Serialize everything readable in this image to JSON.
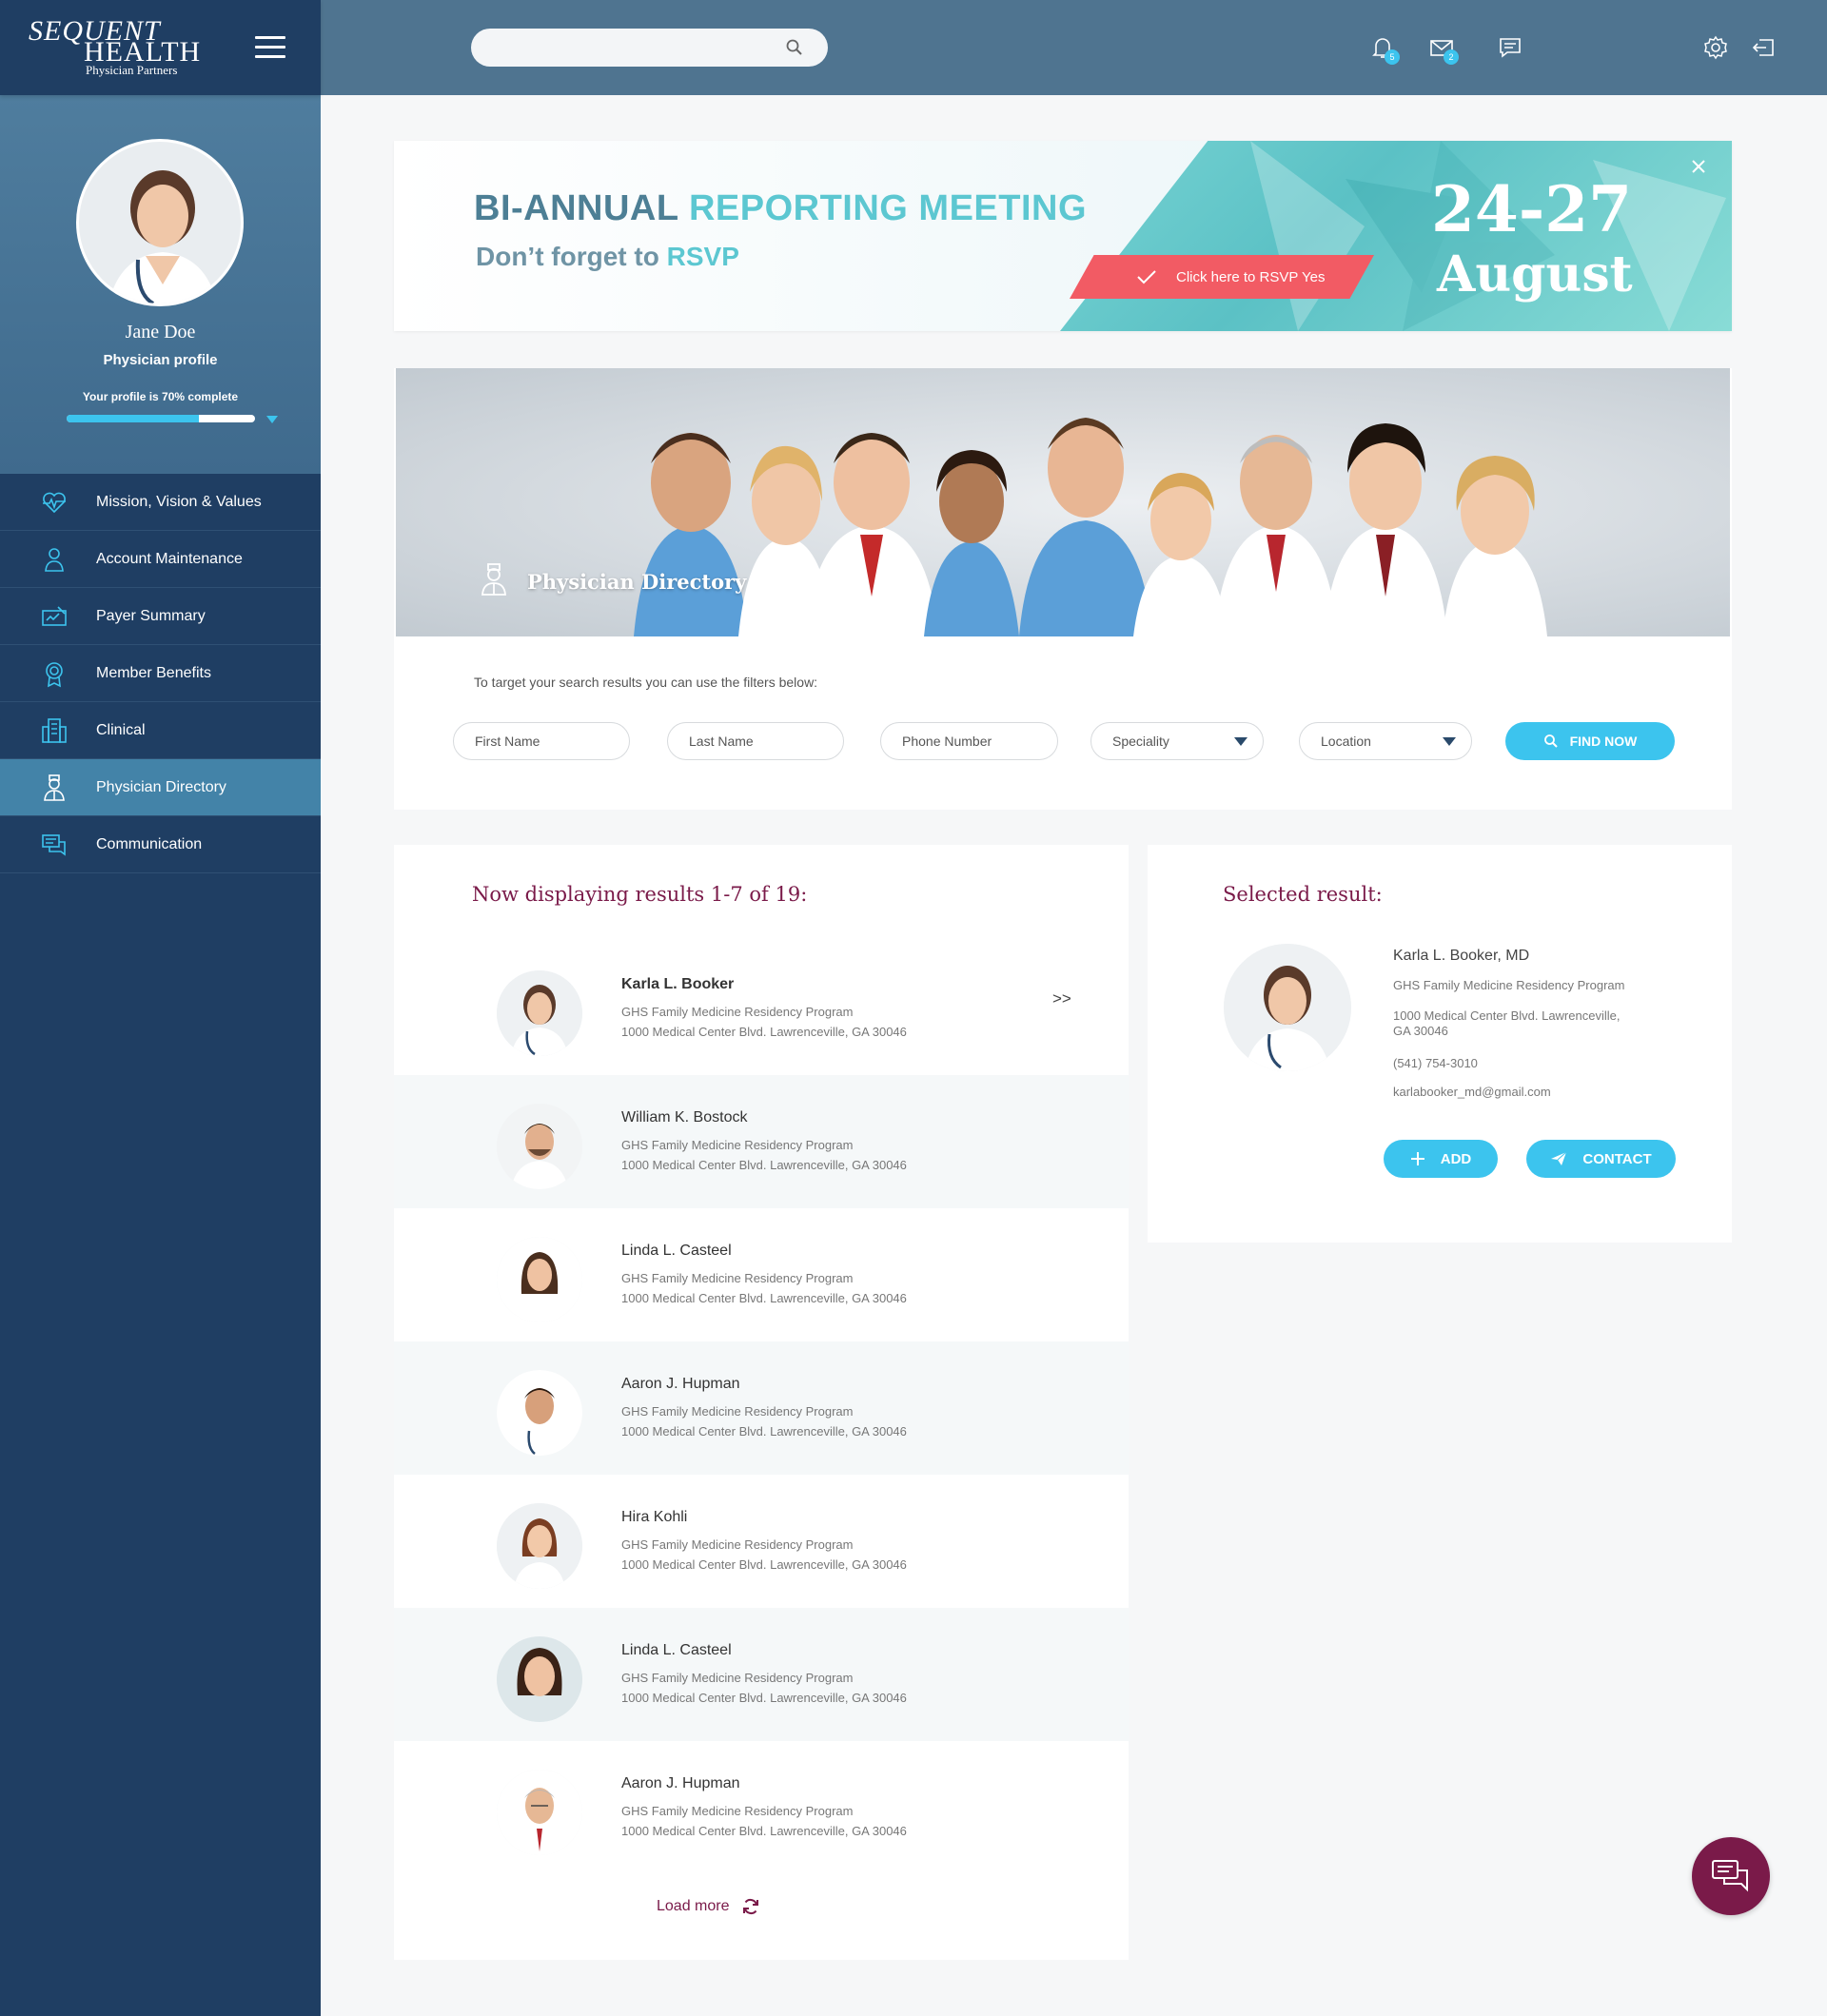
{
  "brand": {
    "line1": "SEQUENT",
    "line2": "HEALTH",
    "line3": "Physician Partners"
  },
  "user": {
    "name": "Jane Doe",
    "role": "Physician profile",
    "completion_text": "Your profile is 70% complete",
    "completion": 0.7
  },
  "nav": {
    "items": [
      {
        "label": "Mission, Vision & Values",
        "icon": "heart-pulse-icon",
        "active": false
      },
      {
        "label": "Account Maintenance",
        "icon": "user-icon",
        "active": false
      },
      {
        "label": "Payer Summary",
        "icon": "check-signature-icon",
        "active": false
      },
      {
        "label": "Member Benefits",
        "icon": "award-icon",
        "active": false
      },
      {
        "label": "Clinical",
        "icon": "building-icon",
        "active": false
      },
      {
        "label": "Physician Directory",
        "icon": "doctor-icon",
        "active": true
      },
      {
        "label": "Communication",
        "icon": "chat-icon",
        "active": false
      }
    ]
  },
  "topbar": {
    "search_placeholder": "",
    "notifications_count": "5",
    "messages_count": "2"
  },
  "banner": {
    "title_part1": "BI-ANNUAL ",
    "title_part2": "REPORTING MEETING",
    "subtitle_part1": "Don’t forget to ",
    "subtitle_part2": "RSVP",
    "rsvp_label": "Click here to RSVP Yes",
    "date_range": "24-27",
    "month": "August"
  },
  "directory": {
    "title": "Physician Directory",
    "filter_note": "To target your search results you can use the filters below:",
    "first_name_placeholder": "First Name",
    "last_name_placeholder": "Last Name",
    "phone_placeholder": "Phone Number",
    "speciality_label": "Speciality",
    "location_label": "Location",
    "find_label": "FIND NOW"
  },
  "results": {
    "title": "Now displaying results 1-7 of 19:",
    "more_arrow": ">>",
    "load_more": "Load more",
    "items": [
      {
        "name": "Karla L. Booker",
        "program": "GHS Family Medicine Residency Program",
        "address": "1000 Medical Center Blvd. Lawrenceville, GA 30046"
      },
      {
        "name": "William K. Bostock",
        "program": "GHS Family Medicine Residency Program",
        "address": "1000 Medical Center Blvd. Lawrenceville, GA 30046"
      },
      {
        "name": "Linda L. Casteel",
        "program": "GHS Family Medicine Residency Program",
        "address": "1000 Medical Center Blvd. Lawrenceville, GA 30046"
      },
      {
        "name": "Aaron J. Hupman",
        "program": "GHS Family Medicine Residency Program",
        "address": "1000 Medical Center Blvd. Lawrenceville, GA 30046"
      },
      {
        "name": "Hira Kohli",
        "program": "GHS Family Medicine Residency Program",
        "address": "1000 Medical Center Blvd. Lawrenceville, GA 30046"
      },
      {
        "name": "Linda L. Casteel",
        "program": "GHS Family Medicine Residency Program",
        "address": "1000 Medical Center Blvd. Lawrenceville, GA 30046"
      },
      {
        "name": "Aaron J. Hupman",
        "program": "GHS Family Medicine Residency Program",
        "address": "1000 Medical Center Blvd. Lawrenceville, GA 30046"
      }
    ]
  },
  "selected": {
    "title": "Selected result:",
    "name": "Karla L. Booker, MD",
    "program": "GHS Family Medicine Residency Program",
    "address_line1": "1000 Medical Center Blvd. Lawrenceville,",
    "address_line2": "GA 30046",
    "phone": "(541) 754-3010",
    "email": "karlabooker_md@gmail.com",
    "add_label": "ADD",
    "contact_label": "CONTACT"
  },
  "colors": {
    "accent": "#3cc4ee",
    "brand_dark": "#1f3e63",
    "heading": "#7a1a49",
    "rsvp": "#f25b64"
  }
}
